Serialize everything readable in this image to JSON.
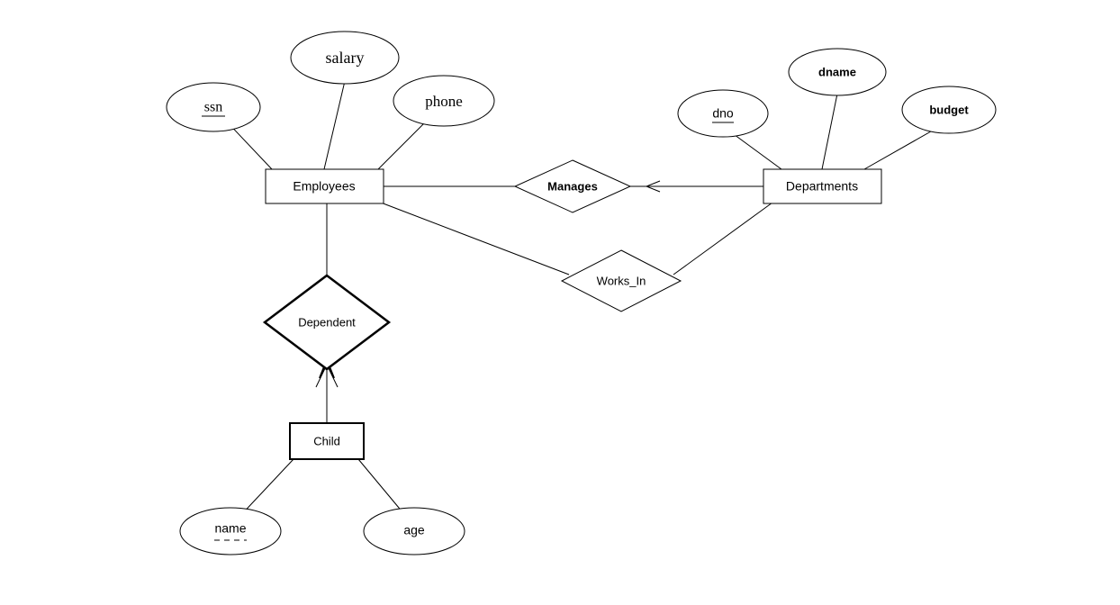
{
  "diagram": {
    "entities": {
      "employees": "Employees",
      "departments": "Departments",
      "child": "Child"
    },
    "relationships": {
      "manages": "Manages",
      "works_in": "Works_In",
      "dependent": "Dependent"
    },
    "attributes": {
      "ssn": "ssn",
      "salary": "salary",
      "phone": "phone",
      "dno": "dno",
      "dname": "dname",
      "budget": "budget",
      "name": "name",
      "age": "age"
    }
  }
}
